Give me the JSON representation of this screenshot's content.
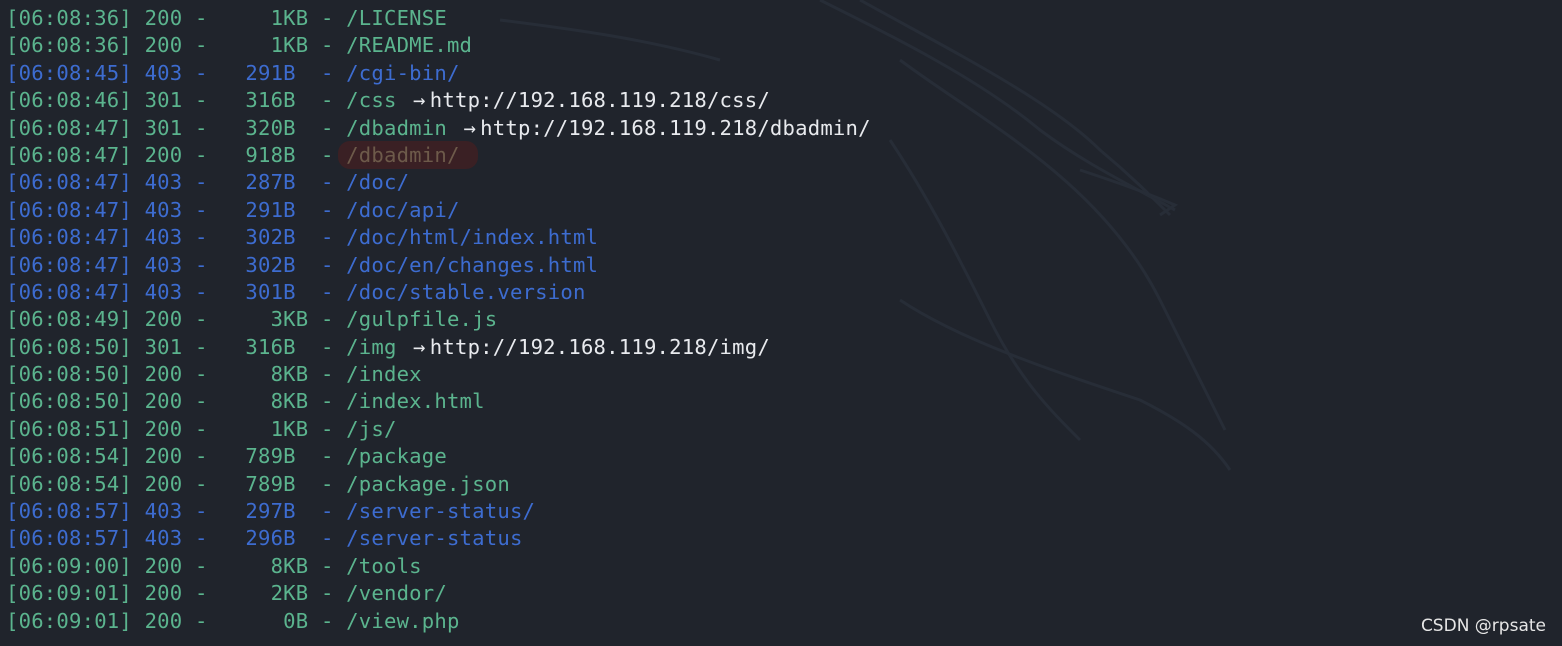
{
  "colors": {
    "background": "#20242c",
    "status_ok": "#5bb48e",
    "status_forbidden": "#3d6cd0",
    "redirect_text": "#e8eaee",
    "highlight_bg": "#3a2024"
  },
  "log_lines": [
    {
      "time": "[06:08:36]",
      "status": "200",
      "size": "  1KB",
      "path": "/LICENSE",
      "redirect": ""
    },
    {
      "time": "[06:08:36]",
      "status": "200",
      "size": "  1KB",
      "path": "/README.md",
      "redirect": ""
    },
    {
      "time": "[06:08:45]",
      "status": "403",
      "size": "291B ",
      "path": "/cgi-bin/",
      "redirect": ""
    },
    {
      "time": "[06:08:46]",
      "status": "301",
      "size": "316B ",
      "path": "/css ",
      "redirect": "http://192.168.119.218/css/"
    },
    {
      "time": "[06:08:47]",
      "status": "301",
      "size": "320B ",
      "path": "/dbadmin ",
      "redirect": "http://192.168.119.218/dbadmin/"
    },
    {
      "time": "[06:08:47]",
      "status": "200",
      "size": "918B ",
      "path": "/dbadmin/",
      "redirect": "",
      "highlight": true
    },
    {
      "time": "[06:08:47]",
      "status": "403",
      "size": "287B ",
      "path": "/doc/",
      "redirect": ""
    },
    {
      "time": "[06:08:47]",
      "status": "403",
      "size": "291B ",
      "path": "/doc/api/",
      "redirect": ""
    },
    {
      "time": "[06:08:47]",
      "status": "403",
      "size": "302B ",
      "path": "/doc/html/index.html",
      "redirect": ""
    },
    {
      "time": "[06:08:47]",
      "status": "403",
      "size": "302B ",
      "path": "/doc/en/changes.html",
      "redirect": ""
    },
    {
      "time": "[06:08:47]",
      "status": "403",
      "size": "301B ",
      "path": "/doc/stable.version",
      "redirect": ""
    },
    {
      "time": "[06:08:49]",
      "status": "200",
      "size": "  3KB",
      "path": "/gulpfile.js",
      "redirect": ""
    },
    {
      "time": "[06:08:50]",
      "status": "301",
      "size": "316B ",
      "path": "/img ",
      "redirect": "http://192.168.119.218/img/"
    },
    {
      "time": "[06:08:50]",
      "status": "200",
      "size": "  8KB",
      "path": "/index",
      "redirect": ""
    },
    {
      "time": "[06:08:50]",
      "status": "200",
      "size": "  8KB",
      "path": "/index.html",
      "redirect": ""
    },
    {
      "time": "[06:08:51]",
      "status": "200",
      "size": "  1KB",
      "path": "/js/",
      "redirect": ""
    },
    {
      "time": "[06:08:54]",
      "status": "200",
      "size": "789B ",
      "path": "/package",
      "redirect": ""
    },
    {
      "time": "[06:08:54]",
      "status": "200",
      "size": "789B ",
      "path": "/package.json",
      "redirect": ""
    },
    {
      "time": "[06:08:57]",
      "status": "403",
      "size": "297B ",
      "path": "/server-status/",
      "redirect": ""
    },
    {
      "time": "[06:08:57]",
      "status": "403",
      "size": "296B ",
      "path": "/server-status",
      "redirect": ""
    },
    {
      "time": "[06:09:00]",
      "status": "200",
      "size": "  8KB",
      "path": "/tools",
      "redirect": ""
    },
    {
      "time": "[06:09:01]",
      "status": "200",
      "size": "  2KB",
      "path": "/vendor/",
      "redirect": ""
    },
    {
      "time": "[06:09:01]",
      "status": "200",
      "size": "   0B",
      "path": "/view.php",
      "redirect": ""
    }
  ],
  "arrow_glyph": "→",
  "watermark": "CSDN @rpsate"
}
